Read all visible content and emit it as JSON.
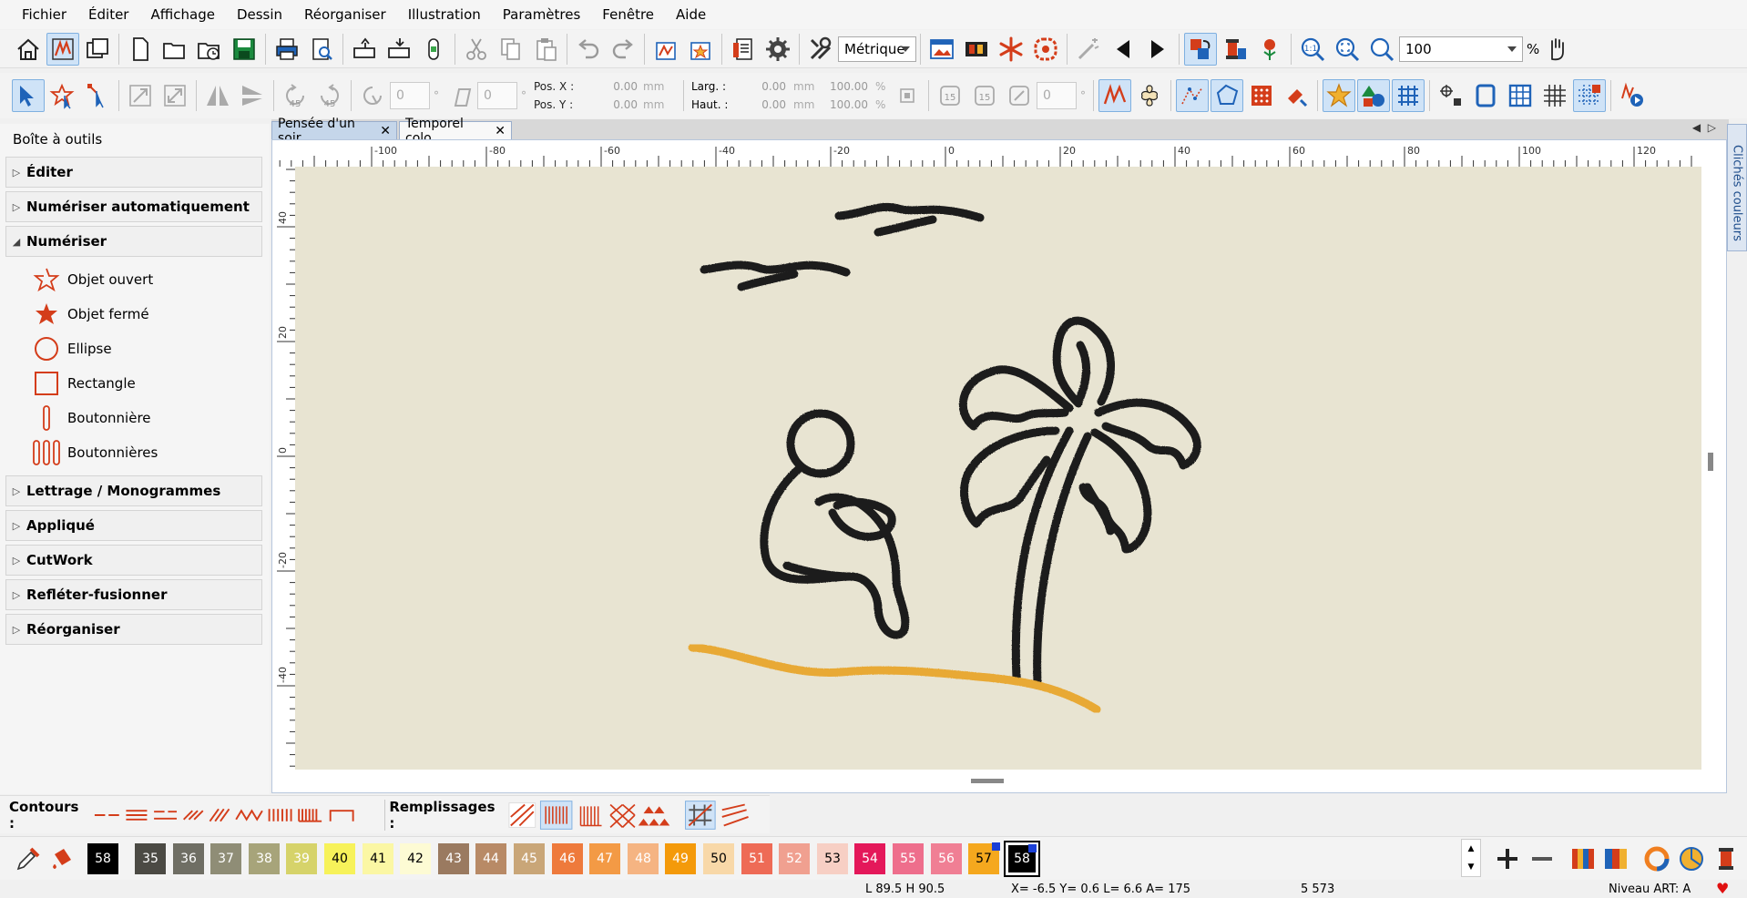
{
  "menu": [
    "Fichier",
    "Éditer",
    "Affichage",
    "Dessin",
    "Réorganiser",
    "Illustration",
    "Paramètres",
    "Fenêtre",
    "Aide"
  ],
  "toolbar": {
    "units_select": "Métrique",
    "zoom_value": "100",
    "zoom_unit": "%"
  },
  "transform": {
    "posx_label": "Pos. X :",
    "posx_value": "0.00",
    "posy_label": "Pos. Y :",
    "posy_value": "0.00",
    "unit": "mm",
    "width_label": "Larg. :",
    "width_value": "0.00",
    "width_pct": "100.00",
    "height_label": "Haut. :",
    "height_value": "0.00",
    "height_pct": "100.00",
    "pct": "%",
    "rotate_value": "0",
    "slant_value": "0",
    "angle_value": "0",
    "rot45a": "45",
    "rot45b": "45",
    "rot15a": "15",
    "rot15b": "15",
    "degree": "°"
  },
  "toolbox": {
    "title": "Boîte à outils",
    "sections": {
      "edit": "Éditer",
      "auto": "Numériser automatiquement",
      "digitize": "Numériser",
      "lettering": "Lettrage / Monogrammes",
      "applique": "Appliqué",
      "cutwork": "CutWork",
      "mirror": "Refléter-fusionner",
      "arrange": "Réorganiser"
    },
    "tools": {
      "open_object": "Objet ouvert",
      "closed_object": "Objet fermé",
      "ellipse": "Ellipse",
      "rectangle": "Rectangle",
      "buttonhole": "Boutonnière",
      "buttonholes": "Boutonnières"
    }
  },
  "tabs": {
    "tab1": "Pensée d'un soir",
    "tab2": "Temporel colo",
    "close": "✕"
  },
  "ruler": {
    "h": [
      "-100",
      "-80",
      "-60",
      "-40",
      "-20",
      "0",
      "20",
      "40",
      "60",
      "80",
      "100",
      "120"
    ],
    "v": [
      "40",
      "20",
      "0",
      "-20",
      "-40"
    ]
  },
  "side_panel": "Clichés couleurs",
  "stitchbar": {
    "outlines_label": "Contours :",
    "fills_label": "Remplissages :"
  },
  "palette": {
    "current": "58",
    "colors": [
      {
        "n": "35",
        "c": "#4b4a44",
        "t": "#ffffff"
      },
      {
        "n": "36",
        "c": "#6f6e64",
        "t": "#ffffff"
      },
      {
        "n": "37",
        "c": "#8f8d76",
        "t": "#ffffff"
      },
      {
        "n": "38",
        "c": "#a7a47a",
        "t": "#ffffff"
      },
      {
        "n": "39",
        "c": "#d6d36a",
        "t": "#ffffff"
      },
      {
        "n": "40",
        "c": "#f7f25a",
        "t": "#000000"
      },
      {
        "n": "41",
        "c": "#fbf7a4",
        "t": "#000000"
      },
      {
        "n": "42",
        "c": "#fdfbd4",
        "t": "#000000"
      },
      {
        "n": "43",
        "c": "#9a7a60",
        "t": "#ffffff"
      },
      {
        "n": "44",
        "c": "#b88a66",
        "t": "#ffffff"
      },
      {
        "n": "45",
        "c": "#c9a678",
        "t": "#ffffff"
      },
      {
        "n": "46",
        "c": "#ee7a3c",
        "t": "#ffffff"
      },
      {
        "n": "47",
        "c": "#f39a45",
        "t": "#ffffff"
      },
      {
        "n": "48",
        "c": "#f5b482",
        "t": "#ffffff"
      },
      {
        "n": "49",
        "c": "#f49a0a",
        "t": "#ffffff"
      },
      {
        "n": "50",
        "c": "#f8d8a8",
        "t": "#000000"
      },
      {
        "n": "51",
        "c": "#ee6b56",
        "t": "#ffffff"
      },
      {
        "n": "52",
        "c": "#f0a090",
        "t": "#ffffff"
      },
      {
        "n": "53",
        "c": "#f7cfc4",
        "t": "#000000"
      },
      {
        "n": "54",
        "c": "#e4185a",
        "t": "#ffffff"
      },
      {
        "n": "55",
        "c": "#ee6e8c",
        "t": "#ffffff"
      },
      {
        "n": "56",
        "c": "#f07f94",
        "t": "#ffffff"
      },
      {
        "n": "57",
        "c": "#f5a81e",
        "t": "#000000"
      },
      {
        "n": "58",
        "c": "#000000",
        "t": "#ffffff"
      }
    ]
  },
  "status": {
    "size": "L  89.5 H  90.5",
    "coords": "X=  -6.5 Y=   0.6 L=   6.6 A= 175",
    "stitches": "5 573",
    "level": "Niveau ART: A"
  },
  "colors": {
    "accent_red": "#d43d1a",
    "accent_blue": "#1f63b8",
    "thread_black": "#1c1c1c",
    "thread_gold": "#e8a935",
    "fabric": "#e8e4d2"
  }
}
